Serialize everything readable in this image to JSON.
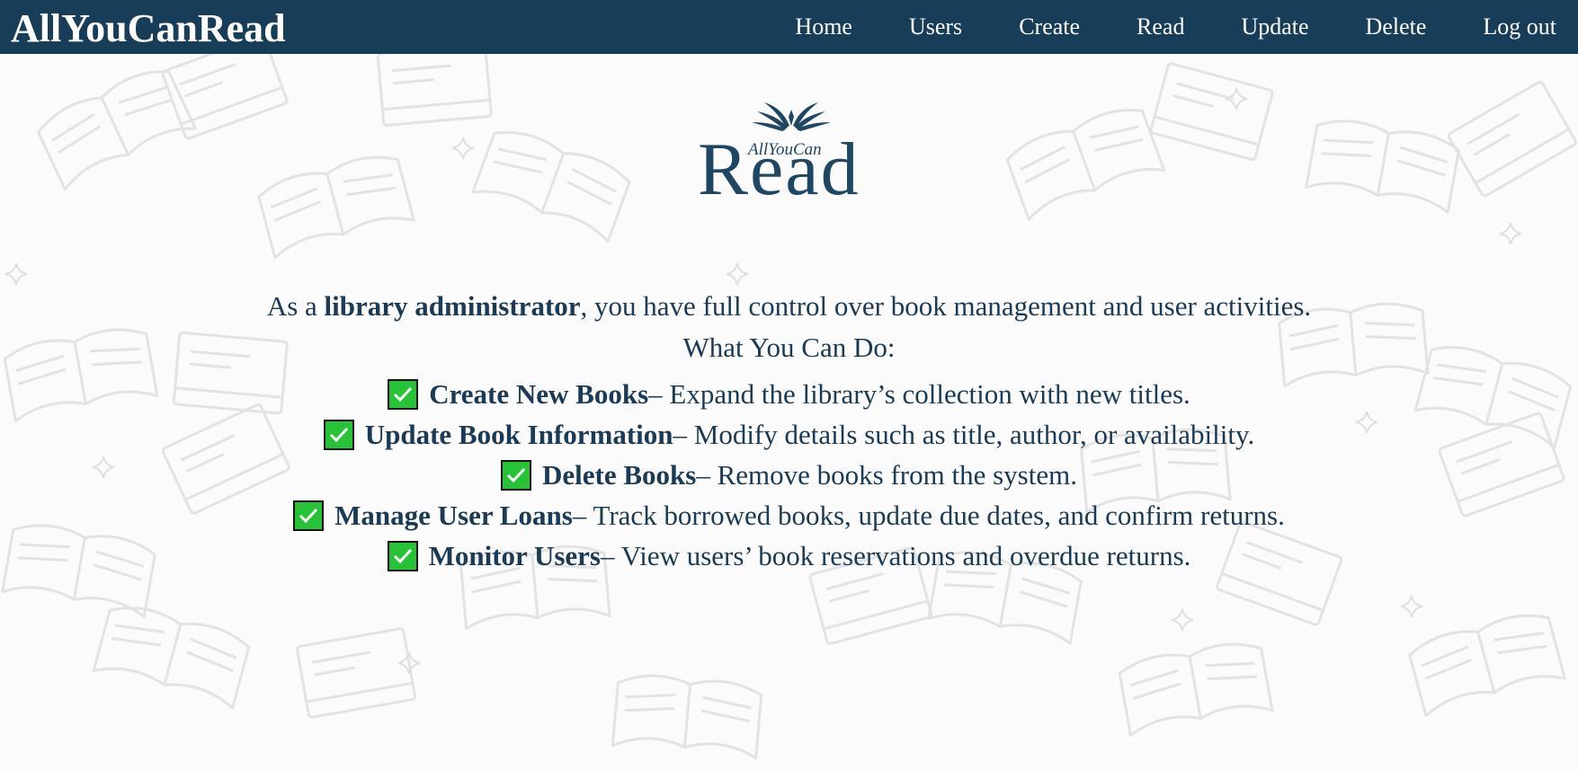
{
  "navbar": {
    "brand": "AllYouCanRead",
    "links": [
      "Home",
      "Users",
      "Create",
      "Read",
      "Update",
      "Delete",
      "Log out"
    ]
  },
  "logo": {
    "icon": "open-book-icon",
    "small_text": "AllYouCan",
    "large_text": "Read"
  },
  "intro": {
    "prefix": "As a ",
    "role": "library administrator",
    "suffix": ", you have full control over book management and user activities.",
    "heading": "What You Can Do:"
  },
  "features": [
    {
      "title": "Create New Books",
      "description": " – Expand the library’s collection with new titles."
    },
    {
      "title": "Update Book Information",
      "description": " – Modify details such as title, author, or availability."
    },
    {
      "title": "Delete Books",
      "description": " – Remove books from the system."
    },
    {
      "title": "Manage User Loans",
      "description": " – Track borrowed books, update due dates, and confirm returns."
    },
    {
      "title": "Monitor Users",
      "description": " – View users’ book reservations and overdue returns."
    }
  ],
  "colors": {
    "navbar_bg": "#183d58",
    "text": "#1a3a55",
    "check_green": "#26c336"
  }
}
